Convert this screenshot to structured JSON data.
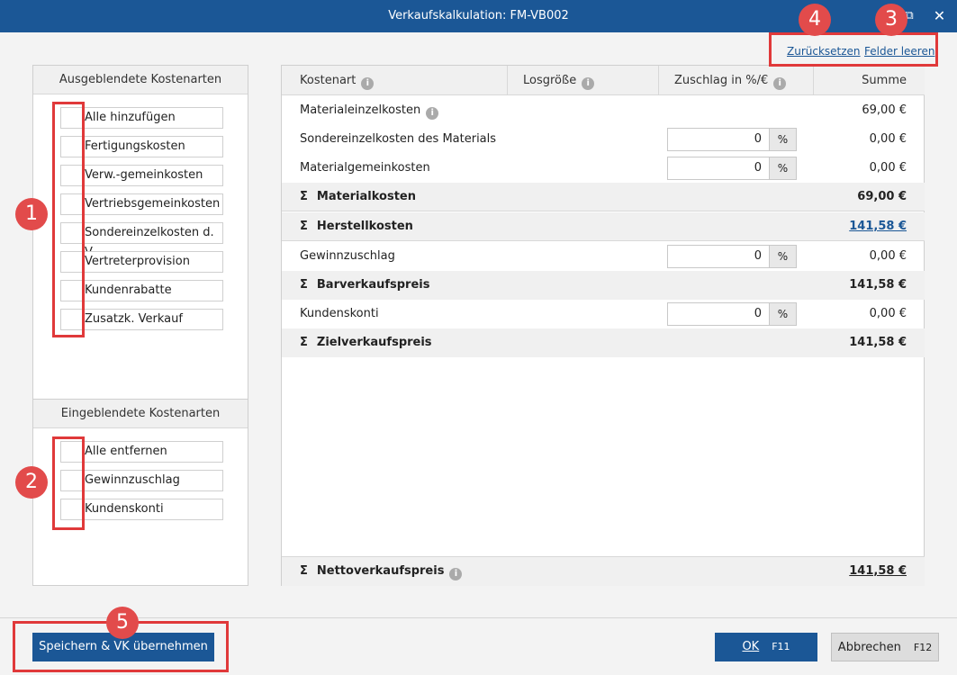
{
  "window": {
    "title": "Verkaufskalkulation: FM-VB002",
    "maximize_icon": "⧉",
    "close_icon": "✕"
  },
  "links": {
    "reset": "Zurücksetzen",
    "clear": "Felder leeren"
  },
  "hidden_panel": {
    "title": "Ausgeblendete Kostenarten",
    "icon": "+",
    "items": [
      "Alle hinzufügen",
      "Fertigungskosten",
      "Verw.-gemeinkosten",
      "Vertriebsgemeinkosten",
      "Sondereinzelkosten d. V.",
      "Vertreterprovision",
      "Kundenrabatte",
      "Zusatzk. Verkauf"
    ]
  },
  "shown_panel": {
    "title": "Eingeblendete Kostenarten",
    "icon": "✕",
    "items": [
      "Alle entfernen",
      "Gewinnzuschlag",
      "Kundenskonti"
    ]
  },
  "table": {
    "headers": {
      "kostenart": "Kostenart",
      "losgroesse": "Losgröße",
      "zuschlag": "Zuschlag in %/€",
      "summe": "Summe"
    },
    "rows": [
      {
        "name": "Materialeinzelkosten",
        "sum": "69,00 €"
      },
      {
        "name": "Sondereinzelkosten des Materials",
        "value": "0",
        "unit": "%",
        "sum": "0,00 €"
      },
      {
        "name": "Materialgemeinkosten",
        "value": "0",
        "unit": "%",
        "sum": "0,00 €"
      },
      {
        "name": "Materialkosten",
        "sum": "69,00 €"
      },
      {
        "name": "Herstellkosten",
        "sum": "141,58 €"
      },
      {
        "name": "Gewinnzuschlag",
        "value": "0",
        "unit": "%",
        "sum": "0,00 €"
      },
      {
        "name": "Barverkaufspreis",
        "sum": "141,58 €"
      },
      {
        "name": "Kundenskonti",
        "value": "0",
        "unit": "%",
        "sum": "0,00 €"
      },
      {
        "name": "Zielverkaufspreis",
        "sum": "141,58 €"
      }
    ],
    "sigma": "Σ",
    "total": {
      "name": "Nettoverkaufspreis",
      "sum": "141,58 €"
    }
  },
  "footer": {
    "save": "Speichern & VK übernehmen",
    "ok": "OK",
    "ok_key": "F11",
    "cancel": "Abbrechen",
    "cancel_key": "F12"
  },
  "badges": [
    "1",
    "2",
    "3",
    "4",
    "5"
  ],
  "colors": {
    "brand": "#1b5796",
    "annotation": "#e0393a"
  }
}
